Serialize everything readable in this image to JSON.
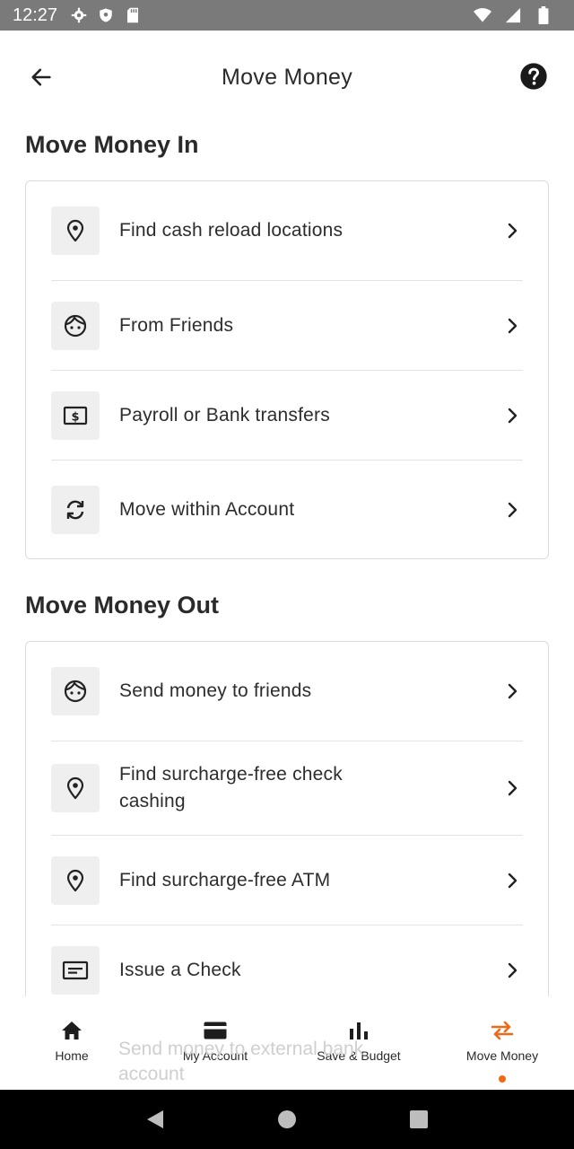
{
  "status_bar": {
    "time": "12:27"
  },
  "header": {
    "title": "Move Money"
  },
  "sections": {
    "money_in": {
      "title": "Move Money In",
      "items": [
        {
          "label": "Find cash reload locations",
          "icon": "location-pin-icon"
        },
        {
          "label": "From Friends",
          "icon": "friend-face-icon"
        },
        {
          "label": "Payroll or Bank transfers",
          "icon": "dollar-bill-icon"
        },
        {
          "label": "Move within Account",
          "icon": "sync-arrows-icon"
        }
      ]
    },
    "money_out": {
      "title": "Move Money Out",
      "items": [
        {
          "label": "Send money to friends",
          "icon": "friend-face-icon"
        },
        {
          "label": "Find surcharge-free check cashing",
          "icon": "location-pin-icon"
        },
        {
          "label": "Find surcharge-free ATM",
          "icon": "location-pin-icon"
        },
        {
          "label": "Issue a Check",
          "icon": "check-icon"
        },
        {
          "label": "Send money to external bank account",
          "icon": "bank-icon"
        }
      ]
    }
  },
  "bottom_nav": {
    "items": [
      {
        "label": "Home",
        "icon": "home-icon"
      },
      {
        "label": "My Account",
        "icon": "card-icon"
      },
      {
        "label": "Save & Budget",
        "icon": "bar-chart-icon"
      },
      {
        "label": "Move Money",
        "icon": "transfer-arrows-icon",
        "active": true
      }
    ]
  },
  "colors": {
    "accent": "#ee6a18",
    "text": "#2a2a2a",
    "icon_bg": "#efefef",
    "status_bar": "#7a7a7a"
  }
}
